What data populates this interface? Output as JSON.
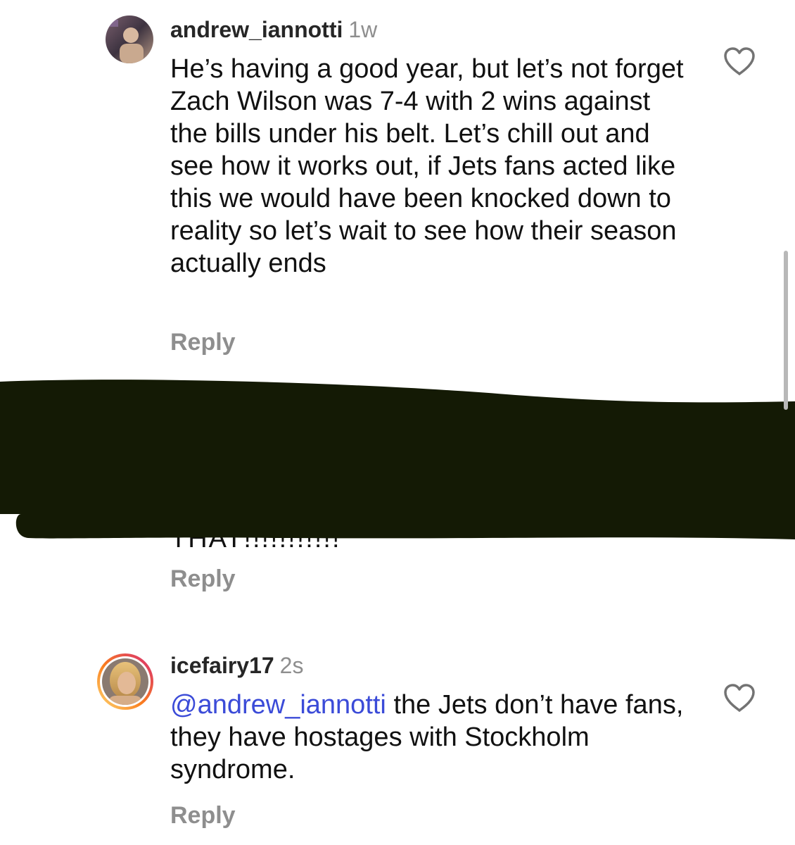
{
  "comments": [
    {
      "username": "andrew_iannotti",
      "time": "1w",
      "text": "He’s having a good year, but let’s not forget Zach Wilson was 7-4 with 2 wins against the bills under his belt. Let’s chill out and see how it works out, if Jets fans acted like this we would have been knocked down to reality so let’s wait to see how their season actually ends",
      "reply_label": "Reply",
      "icons": {
        "like": "heart-outline-icon"
      }
    },
    {
      "redacted": true,
      "visible_fragment": "THAT!!!!!!!!!!!",
      "reply_label": "Reply"
    },
    {
      "username": "icefairy17",
      "time": "2s",
      "mention": "@andrew_iannotti",
      "text": " the Jets don’t have fans, they have hostages with Stockholm syndrome.",
      "reply_label": "Reply",
      "has_story_ring": true,
      "icons": {
        "like": "heart-outline-icon"
      }
    }
  ],
  "colors": {
    "username": "#262626",
    "meta": "#8e8e8e",
    "mention": "#3b4bd8",
    "redaction": "#141a05",
    "story_ring_start": "#feda75",
    "story_ring_mid": "#fa7e1e",
    "story_ring_end": "#d62976"
  }
}
